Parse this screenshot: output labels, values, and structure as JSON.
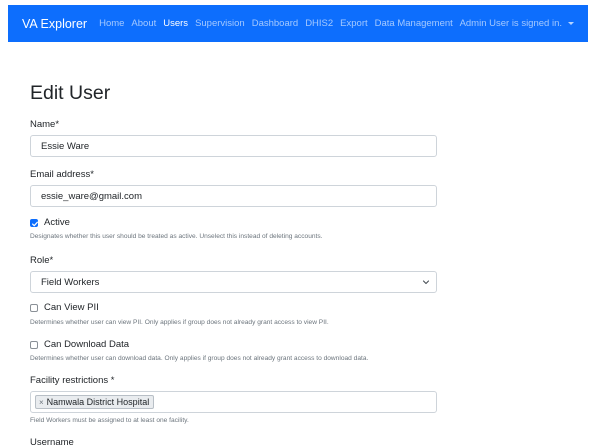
{
  "navbar": {
    "brand": "VA Explorer",
    "links": [
      "Home",
      "About",
      "Users",
      "Supervision",
      "Dashboard",
      "DHIS2",
      "Export",
      "Data Management"
    ],
    "active_link": "Users",
    "user_menu": "Admin User is signed in.",
    "color": "#0d6efd"
  },
  "page": {
    "title": "Edit User"
  },
  "form": {
    "name": {
      "label": "Name*",
      "value": "Essie Ware"
    },
    "email": {
      "label": "Email address*",
      "value": "essie_ware@gmail.com"
    },
    "active": {
      "label": "Active",
      "checked": true,
      "help": "Designates whether this user should be treated as active. Unselect this instead of deleting accounts."
    },
    "role": {
      "label": "Role*",
      "value": "Field Workers"
    },
    "can_view_pii": {
      "label": "Can View PII",
      "checked": false,
      "help": "Determines whether user can view PII. Only applies if group does not already grant access to view PII."
    },
    "can_download_data": {
      "label": "Can Download Data",
      "checked": false,
      "help": "Determines whether user can download data. Only applies if group does not already grant access to download data."
    },
    "facility_restrictions": {
      "label": "Facility restrictions *",
      "selected": [
        "Namwala District Hospital"
      ],
      "remove_glyph": "×",
      "help": "Field Workers must be assigned to at least one facility."
    },
    "username": {
      "label": "Username"
    }
  }
}
